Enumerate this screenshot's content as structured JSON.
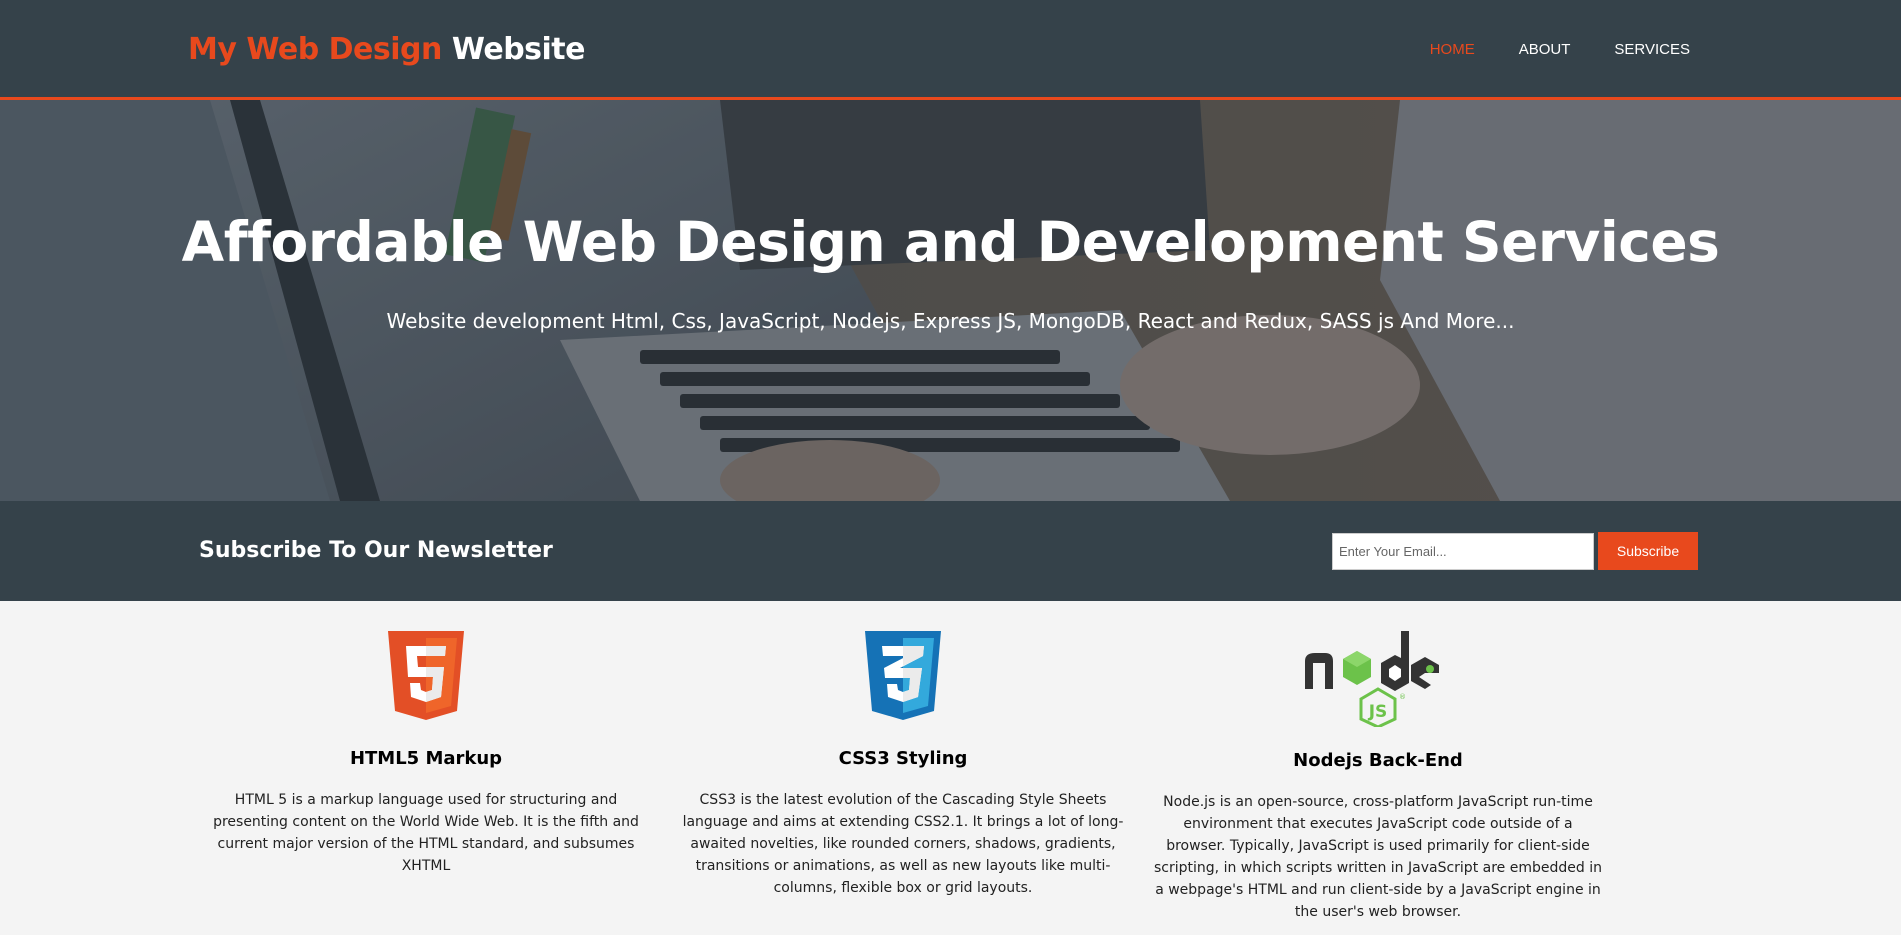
{
  "header": {
    "brand_highlight": "My Web Design",
    "brand_rest": "Website",
    "nav": [
      {
        "label": "HOME",
        "active": true
      },
      {
        "label": "ABOUT",
        "active": false
      },
      {
        "label": "SERVICES",
        "active": false
      }
    ]
  },
  "hero": {
    "title": "Affordable Web Design and Development Services",
    "subtitle": "Website development Html, Css, JavaScript, Nodejs, Express JS, MongoDB, React and Redux, SASS js And More..."
  },
  "newsletter": {
    "heading": "Subscribe To Our Newsletter",
    "email_placeholder": "Enter Your Email...",
    "button_label": "Subscribe"
  },
  "boxes": [
    {
      "icon": "html5-logo-icon",
      "title": "HTML5 Markup",
      "text": "HTML 5 is a markup language used for structuring and presenting content on the World Wide Web. It is the fifth and current major version of the HTML standard, and subsumes XHTML"
    },
    {
      "icon": "css3-logo-icon",
      "title": "CSS3 Styling",
      "text": "CSS3 is the latest evolution of the Cascading Style Sheets language and aims at extending CSS2.1. It brings a lot of long-awaited novelties, like rounded corners, shadows, gradients, transitions or animations, as well as new layouts like multi-columns, flexible box or grid layouts."
    },
    {
      "icon": "nodejs-logo-icon",
      "title": "Nodejs Back-End",
      "text": "Node.js is an open-source, cross-platform JavaScript run-time environment that executes JavaScript code outside of a browser. Typically, JavaScript is used primarily for client-side scripting, in which scripts written in JavaScript are embedded in a webpage's HTML and run client-side by a JavaScript engine in the user's web browser."
    }
  ],
  "colors": {
    "header_bg": "#35424a",
    "accent": "#e8491d",
    "page_bg": "#f4f4f4"
  }
}
